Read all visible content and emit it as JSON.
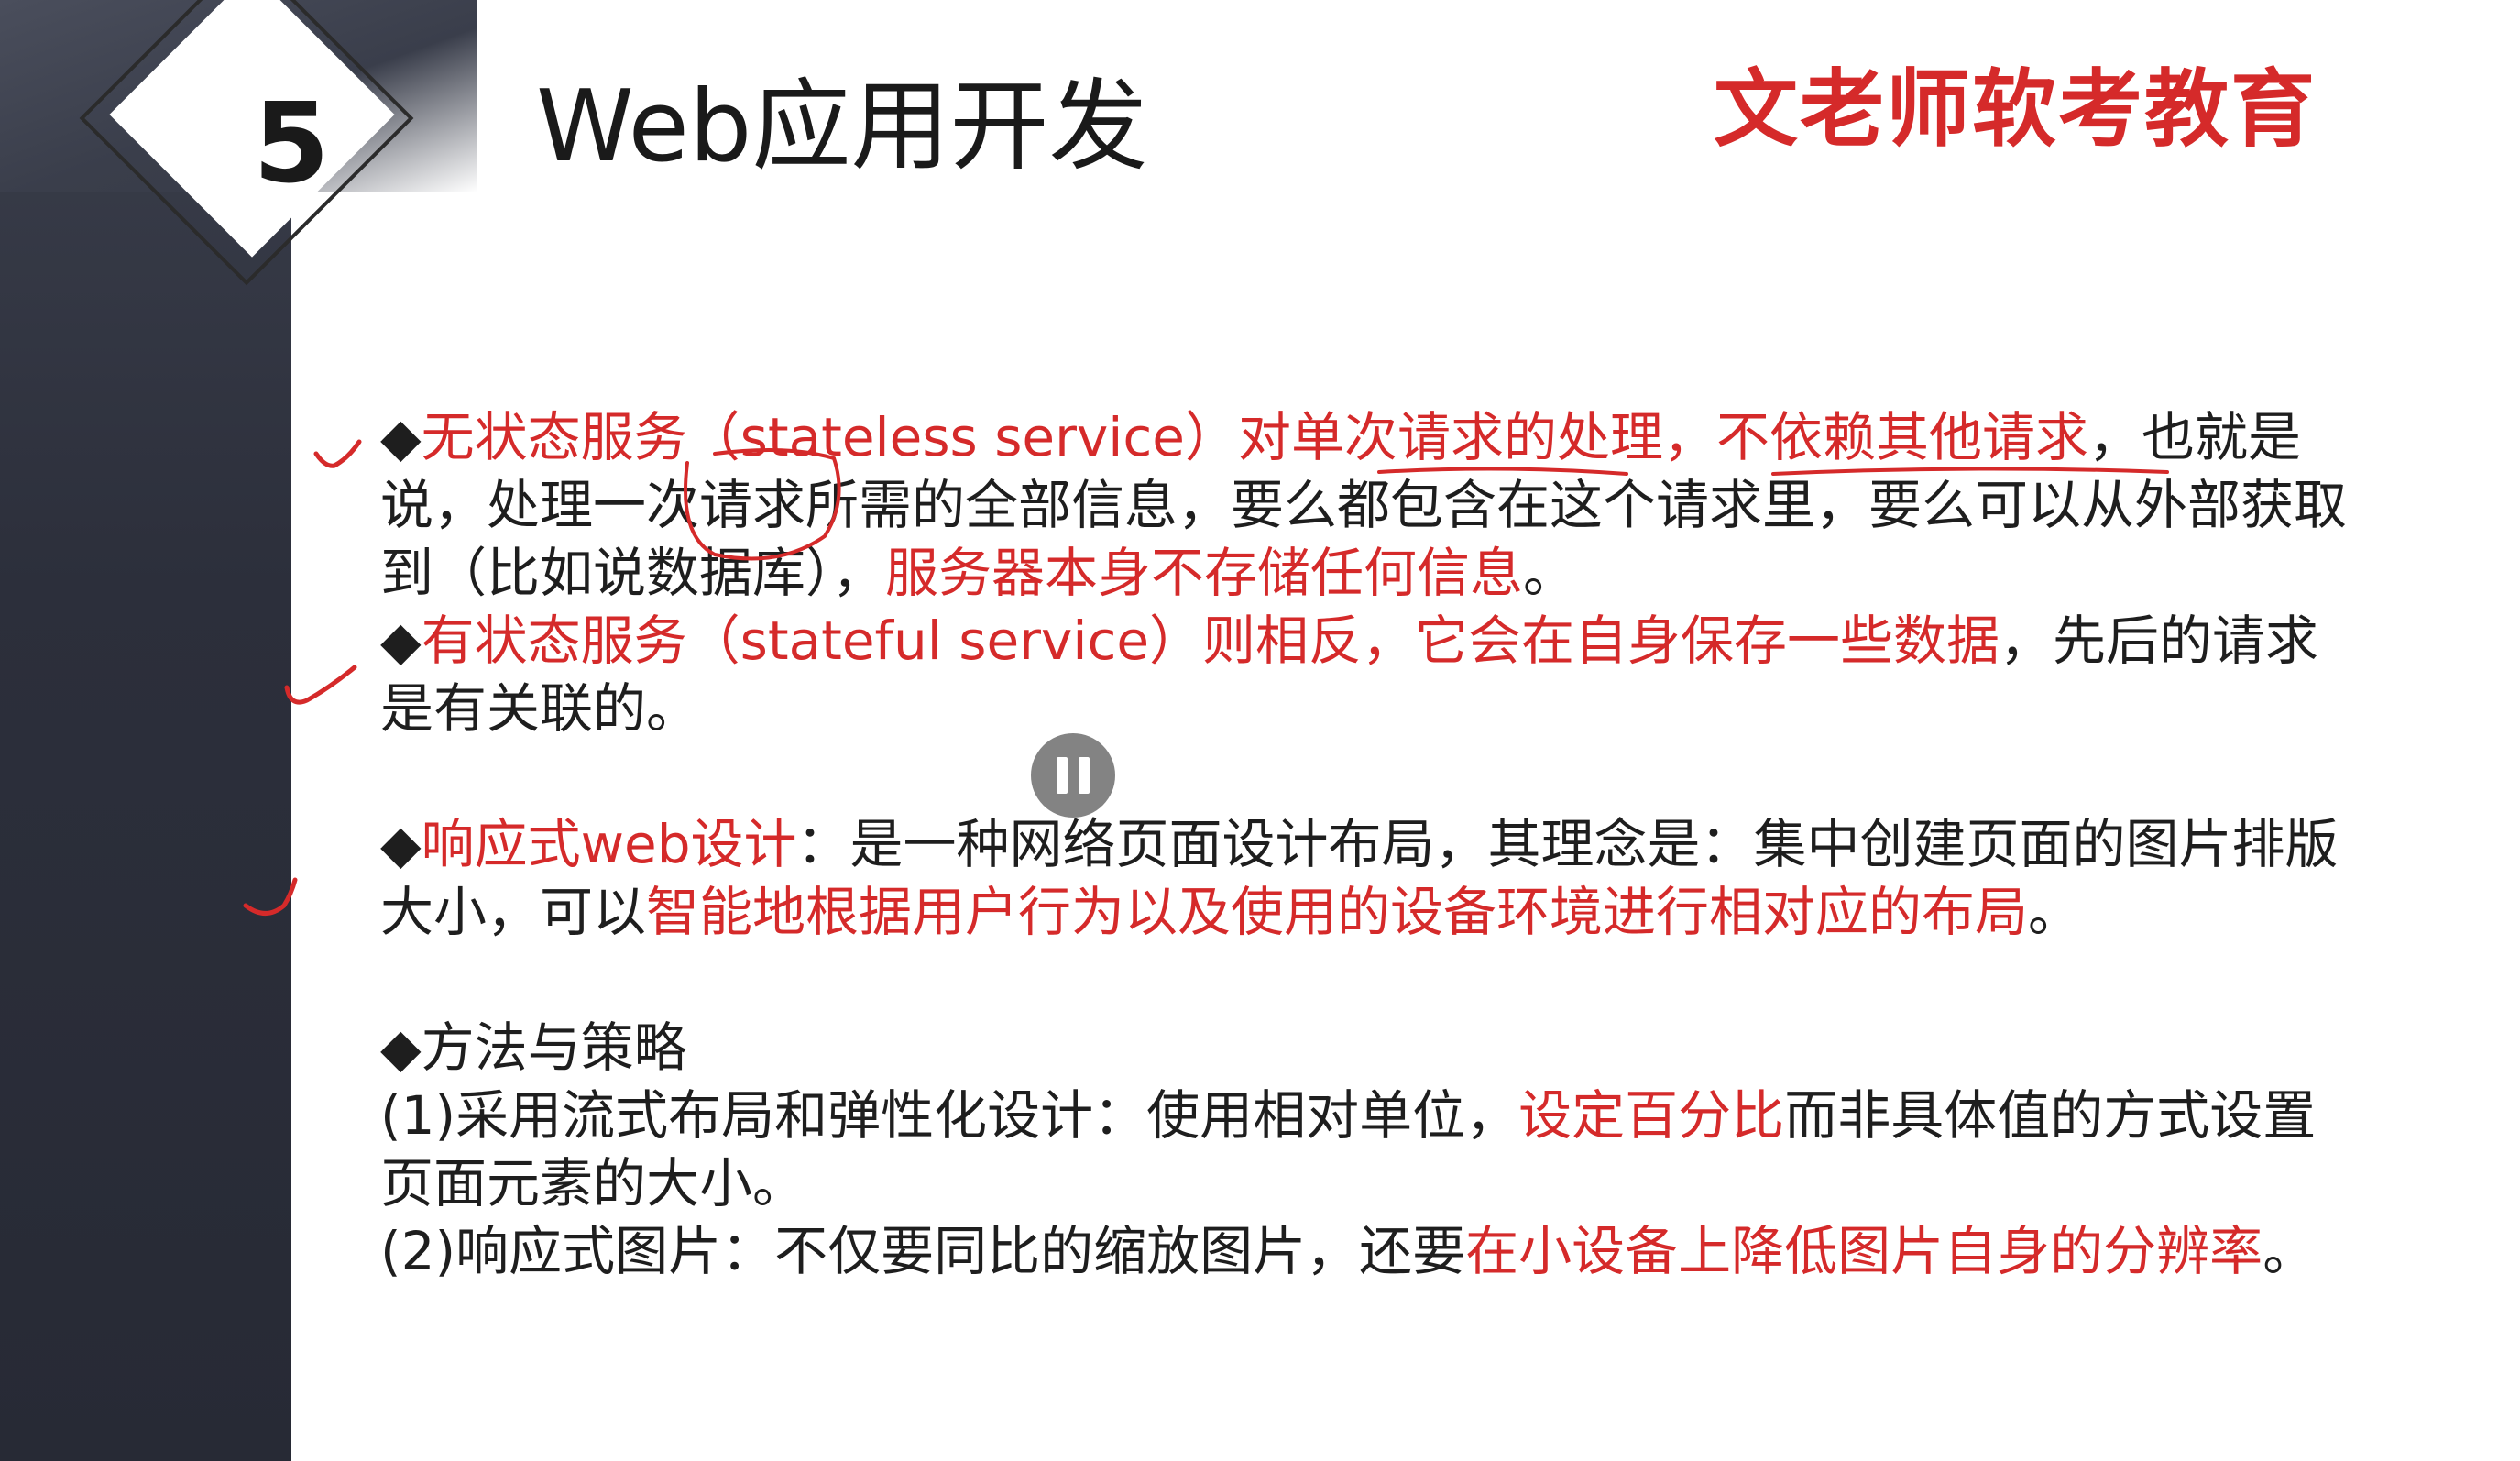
{
  "slide": {
    "number": "5",
    "title": "Web应用开发",
    "brand": "文老师软考教育"
  },
  "content": {
    "p1": {
      "bullet": "◆",
      "red1": "无状态服务（stateless service）对单次请求的处理，不依赖其他请求",
      "black1": "，也就是说，处理一次请求所需的全部信息，要么都包含在这个请求里，要么可以从外部获取到（比如说数据库），",
      "red2": "服务器本身不存储任何信息",
      "black2": "。"
    },
    "p2": {
      "bullet": "◆",
      "red1": "有状态服务（stateful service）则相反，它会在自身保存一些数据",
      "black1": "，先后的请求是有关联的。"
    },
    "p3": {
      "bullet": "◆",
      "red1": "响应式web设计",
      "black1": "：是一种网络页面设计布局，其理念是：集中创建页面的图片排版大小，可以",
      "red2": "智能地根据用户行为以及使用的设备环境进行相对应的布局",
      "black2": "。"
    },
    "p4": {
      "heading": "◆方法与策略",
      "item1_black1": "(1)采用流式布局和弹性化设计：使用相对单位，",
      "item1_red": "设定百分比",
      "item1_black2": "而非具体值的方式设置页面元素的大小。",
      "item2_black1": "(2)响应式图片：不仅要同比的缩放图片，还要",
      "item2_red": "在小设备上降低图片自身的分辨率",
      "item2_black2": "。"
    }
  },
  "player": {
    "pause_icon": "pause-icon"
  },
  "colors": {
    "accent_red": "#d52a2a",
    "text": "#1e1e1e",
    "side_band": "#2c2f3b"
  }
}
